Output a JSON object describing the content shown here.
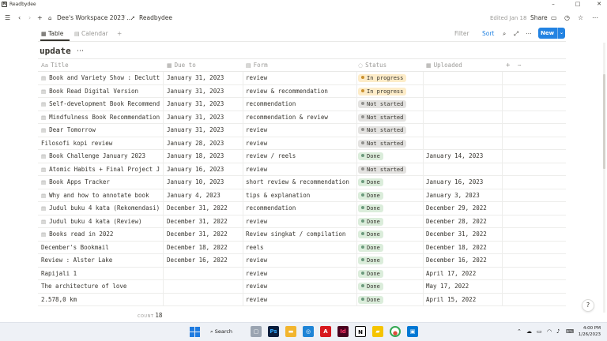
{
  "window": {
    "app_title": "Readbydee",
    "minimize": "–",
    "maximize": "□",
    "close": "✕"
  },
  "nav": {
    "workspace": "Dee's Workspace 2023 ...",
    "separator": "/",
    "page": "Readbydee",
    "edited": "Edited Jan 18",
    "share": "Share"
  },
  "views": {
    "tabs": [
      {
        "label": "Table"
      },
      {
        "label": "Calendar"
      }
    ],
    "filter": "Filter",
    "sort": "Sort",
    "new_label": "New"
  },
  "database": {
    "title": "update",
    "columns": {
      "title": "Title",
      "due": "Due to",
      "form": "Form",
      "status": "Status",
      "uploaded": "Uploaded"
    },
    "rows": [
      {
        "title": "Book and Variety Show : Declutt",
        "due": "January 31, 2023",
        "form": "review",
        "status": "In progress",
        "uploaded": "",
        "doc": true
      },
      {
        "title": "Book Read Digital Version",
        "due": "January 31, 2023",
        "form": "review & recommendation",
        "status": "In progress",
        "uploaded": "",
        "doc": true
      },
      {
        "title": "Self-development Book Recommend",
        "due": "January 31, 2023",
        "form": "recommendation",
        "status": "Not started",
        "uploaded": "",
        "doc": true
      },
      {
        "title": "Mindfulness Book Recommendation",
        "due": "January 31, 2023",
        "form": "recommendation & review",
        "status": "Not started",
        "uploaded": "",
        "doc": true
      },
      {
        "title": "Dear Tomorrow",
        "due": "January 31, 2023",
        "form": "review",
        "status": "Not started",
        "uploaded": "",
        "doc": true
      },
      {
        "title": "Filosofi kopi review",
        "due": "January 28, 2023",
        "form": "review",
        "status": "Not started",
        "uploaded": "",
        "doc": false
      },
      {
        "title": "Book Challenge January 2023",
        "due": "January 18, 2023",
        "form": "review / reels",
        "status": "Done",
        "uploaded": "January 14, 2023",
        "doc": true
      },
      {
        "title": "Atomic Habits + Final Project J",
        "due": "January 16, 2023",
        "form": "review",
        "status": "Not started",
        "uploaded": "",
        "doc": true
      },
      {
        "title": "Book Apps Tracker",
        "due": "January 10, 2023",
        "form": "short review & recommendation",
        "status": "Done",
        "uploaded": "January 16, 2023",
        "doc": true
      },
      {
        "title": "Why and how to annotate book",
        "due": "January 4, 2023",
        "form": "tips & explanation",
        "status": "Done",
        "uploaded": "January 3, 2023",
        "doc": true
      },
      {
        "title": "Judul buku 4 kata (Rekomendasi)",
        "due": "December 31, 2022",
        "form": "recommendation",
        "status": "Done",
        "uploaded": "December 29, 2022",
        "doc": true
      },
      {
        "title": "Judul buku 4 kata (Review)",
        "due": "December 31, 2022",
        "form": "review",
        "status": "Done",
        "uploaded": "December 28, 2022",
        "doc": true
      },
      {
        "title": "Books read in 2022",
        "due": "December 31, 2022",
        "form": "Review singkat / compilation",
        "status": "Done",
        "uploaded": "December 31, 2022",
        "doc": true
      },
      {
        "title": "December's Bookmail",
        "due": "December 18, 2022",
        "form": "reels",
        "status": "Done",
        "uploaded": "December 18, 2022",
        "doc": false
      },
      {
        "title": "Review : Alster Lake",
        "due": "December 16, 2022",
        "form": "review",
        "status": "Done",
        "uploaded": "December 16, 2022",
        "doc": false
      },
      {
        "title": "Rapijali 1",
        "due": "",
        "form": "review",
        "status": "Done",
        "uploaded": "April 17, 2022",
        "doc": false
      },
      {
        "title": "The architecture of love",
        "due": "",
        "form": "review",
        "status": "Done",
        "uploaded": "May 17, 2022",
        "doc": false
      },
      {
        "title": "2.578,0 km",
        "due": "",
        "form": "review",
        "status": "Done",
        "uploaded": "April 15, 2022",
        "doc": false
      }
    ],
    "count_label": "COUNT",
    "count_value": "18"
  },
  "status_colors": {
    "In progress": {
      "bg": "#fdecc8",
      "dot": "#cb912f"
    },
    "Not started": {
      "bg": "#e3e2e0",
      "dot": "#91918e"
    },
    "Done": {
      "bg": "#dbeddb",
      "dot": "#6c9b7d"
    }
  },
  "help": "?",
  "taskbar": {
    "search": "Search",
    "time": "4:00 PM",
    "date": "1/26/2023"
  }
}
